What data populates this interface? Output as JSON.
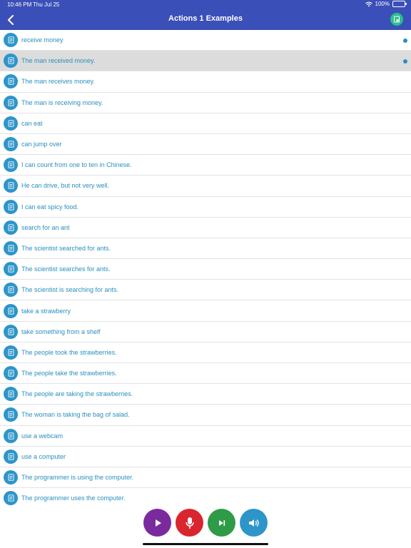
{
  "status": {
    "time": "10:46 PM",
    "date": "Thu Jul 25",
    "battery": "100%"
  },
  "header": {
    "title": "Actions 1 Examples"
  },
  "list": {
    "items": [
      {
        "text": "receive money",
        "selected": false,
        "dot": true
      },
      {
        "text": "The man received money.",
        "selected": true,
        "dot": true
      },
      {
        "text": "The man receives money.",
        "selected": false,
        "dot": false
      },
      {
        "text": "The man is receiving money.",
        "selected": false,
        "dot": false
      },
      {
        "text": "can eat",
        "selected": false,
        "dot": false
      },
      {
        "text": "can jump over",
        "selected": false,
        "dot": false
      },
      {
        "text": "I can count from one to ten in Chinese.",
        "selected": false,
        "dot": false
      },
      {
        "text": "He can drive, but not very well.",
        "selected": false,
        "dot": false
      },
      {
        "text": "I can eat spicy food.",
        "selected": false,
        "dot": false
      },
      {
        "text": "search for an ant",
        "selected": false,
        "dot": false
      },
      {
        "text": "The scientist searched for ants.",
        "selected": false,
        "dot": false
      },
      {
        "text": "The scientist searches for ants.",
        "selected": false,
        "dot": false
      },
      {
        "text": "The scientist is searching for ants.",
        "selected": false,
        "dot": false
      },
      {
        "text": "take a strawberry",
        "selected": false,
        "dot": false
      },
      {
        "text": "take something from a shelf",
        "selected": false,
        "dot": false
      },
      {
        "text": "The people took the strawberries.",
        "selected": false,
        "dot": false
      },
      {
        "text": "The people take the strawberries.",
        "selected": false,
        "dot": false
      },
      {
        "text": "The people are taking the strawberries.",
        "selected": false,
        "dot": false
      },
      {
        "text": "The woman is taking the bag of salad.",
        "selected": false,
        "dot": false
      },
      {
        "text": "use a webcam",
        "selected": false,
        "dot": false
      },
      {
        "text": "use a computer",
        "selected": false,
        "dot": false
      },
      {
        "text": "The programmer is using the computer.",
        "selected": false,
        "dot": false
      },
      {
        "text": "The programmer uses the computer.",
        "selected": false,
        "dot": false
      }
    ]
  },
  "controls": [
    {
      "name": "play-button",
      "icon": "play-icon",
      "color": "#7b2a9e"
    },
    {
      "name": "record-button",
      "icon": "microphone-icon",
      "color": "#d9262e"
    },
    {
      "name": "next-button",
      "icon": "skip-next-icon",
      "color": "#2f9b46"
    },
    {
      "name": "speaker-button",
      "icon": "speaker-icon",
      "color": "#2d95c9"
    }
  ],
  "colors": {
    "header": "#3b4fb8",
    "accent": "#2a8fc0",
    "selected_row": "#dcdcdc"
  }
}
